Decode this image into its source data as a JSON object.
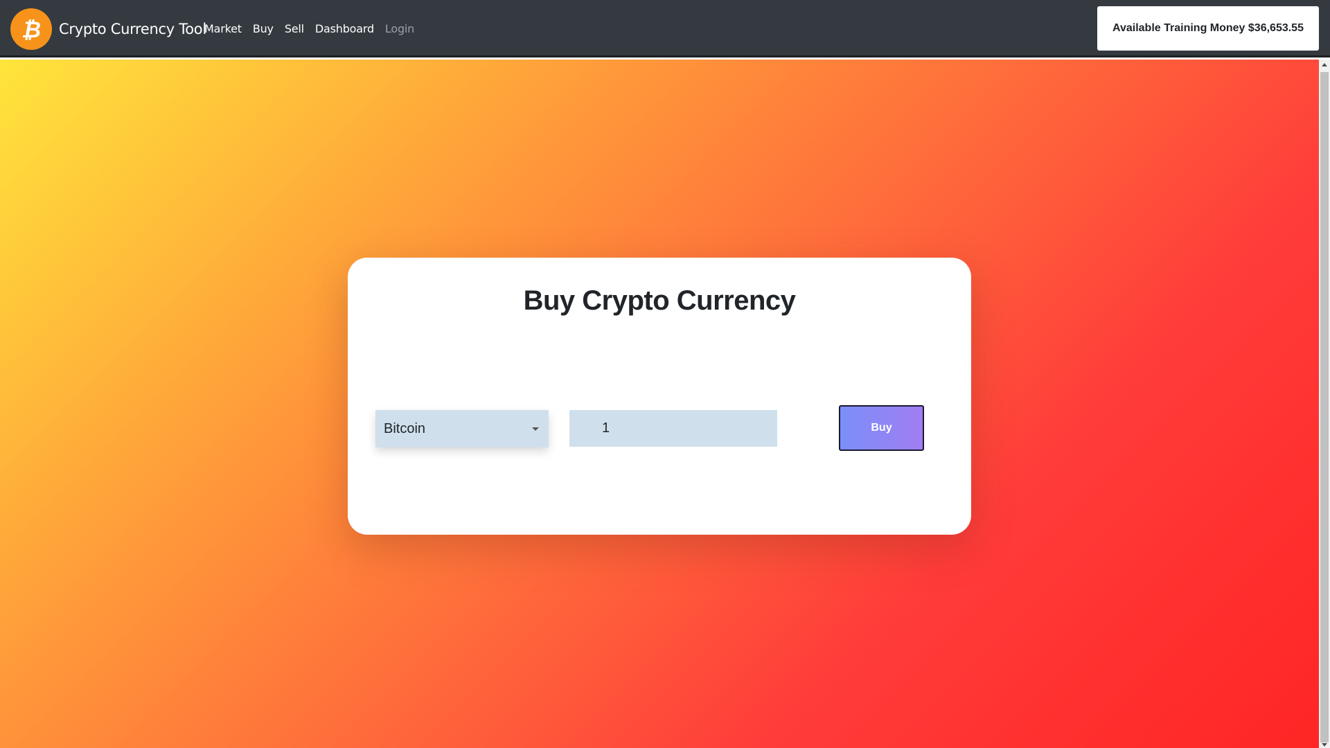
{
  "app": {
    "brand": "Crypto Currency Tool",
    "logo_icon": "bitcoin-icon",
    "logo_color": "#f7931a"
  },
  "nav": {
    "items": [
      {
        "label": "Market",
        "state": "normal"
      },
      {
        "label": "Buy",
        "state": "normal"
      },
      {
        "label": "Sell",
        "state": "normal"
      },
      {
        "label": "Dashboard",
        "state": "normal"
      },
      {
        "label": "Login",
        "state": "muted"
      }
    ]
  },
  "balance": {
    "text": "Available Training Money $36,653.55"
  },
  "buy_form": {
    "title": "Buy Crypto Currency",
    "currency_selected": "Bitcoin",
    "quantity": "1",
    "buy_label": "Buy"
  },
  "colors": {
    "navbar": "#343a40",
    "gradient_start": "#ffe53b",
    "gradient_end": "#ff2525",
    "button_start": "#7b8ffa",
    "button_end": "#a07df0",
    "input_bg": "#d0dfec"
  }
}
